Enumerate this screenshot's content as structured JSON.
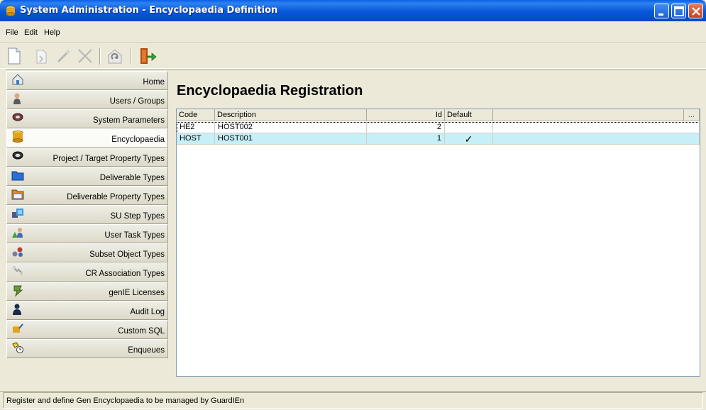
{
  "window": {
    "title": "System Administration - Encyclopaedia Definition"
  },
  "menu": [
    "File",
    "Edit",
    "Help"
  ],
  "toolbar": {
    "buttons": [
      "new-document-icon",
      "copy-icon",
      "wand-icon",
      "delete-icon",
      "refresh-icon",
      "exit-icon"
    ]
  },
  "sidebar": {
    "items": [
      {
        "label": "Home",
        "icon": "home-icon"
      },
      {
        "label": "Users / Groups",
        "icon": "users-icon"
      },
      {
        "label": "System Parameters",
        "icon": "parameters-icon"
      },
      {
        "label": "Encyclopaedia",
        "icon": "encyclopaedia-icon",
        "active": true
      },
      {
        "label": "Project / Target Property Types",
        "icon": "project-icon"
      },
      {
        "label": "Deliverable Types",
        "icon": "folder-icon"
      },
      {
        "label": "Deliverable Property Types",
        "icon": "property-icon"
      },
      {
        "label": "SU Step Types",
        "icon": "su-step-icon"
      },
      {
        "label": "User Task Types",
        "icon": "user-task-icon"
      },
      {
        "label": "Subset Object Types",
        "icon": "subset-icon"
      },
      {
        "label": "CR Association Types",
        "icon": "cr-association-icon"
      },
      {
        "label": "genIE Licenses",
        "icon": "license-icon"
      },
      {
        "label": "Audit Log",
        "icon": "audit-icon"
      },
      {
        "label": "Custom SQL",
        "icon": "sql-icon"
      },
      {
        "label": "Enqueues",
        "icon": "enqueue-icon"
      }
    ]
  },
  "main": {
    "title": "Encyclopaedia Registration",
    "grid": {
      "columns": [
        "Code",
        "Description",
        "Id",
        "Default",
        "..."
      ],
      "rows": [
        {
          "code": "HE2",
          "description": "HOST002",
          "id": "2",
          "default": ""
        },
        {
          "code": "HOST",
          "description": "HOST001",
          "id": "1",
          "default": "✓"
        }
      ]
    }
  },
  "status": {
    "text": "Register and define Gen Encyclopaedia to be managed by GuardIEn"
  },
  "colors": {
    "titlebar": "#0757d8",
    "selected_row": "#c6eff7",
    "background": "#ece9d8"
  }
}
